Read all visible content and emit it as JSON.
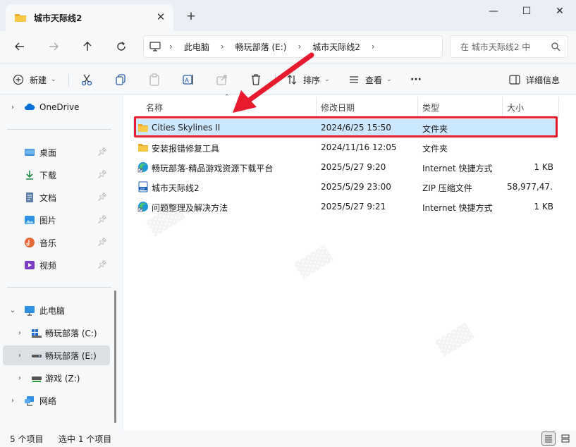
{
  "window": {
    "tab_title": "城市天际线2",
    "close_tab_glyph": "✕",
    "new_tab_glyph": "+",
    "minimize_glyph": "—",
    "maximize_glyph": "☐",
    "close_glyph": "✕"
  },
  "address": {
    "breadcrumbs": [
      "此电脑",
      "畅玩部落 (E:)",
      "城市天际线2"
    ],
    "separator": "›",
    "search_placeholder": "在 城市天际线2 中"
  },
  "toolbar": {
    "new_label": "新建",
    "sort_label": "排序",
    "view_label": "查看",
    "more_label": "···",
    "details_label": "详细信息"
  },
  "sidebar": {
    "onedrive": "OneDrive",
    "quick_access": [
      {
        "label": "桌面",
        "icon": "desktop-icon"
      },
      {
        "label": "下载",
        "icon": "download-icon"
      },
      {
        "label": "文档",
        "icon": "documents-icon"
      },
      {
        "label": "图片",
        "icon": "pictures-icon"
      },
      {
        "label": "音乐",
        "icon": "music-icon"
      },
      {
        "label": "视频",
        "icon": "videos-icon"
      }
    ],
    "this_pc": "此电脑",
    "drives": [
      {
        "label": "畅玩部落 (C:)"
      },
      {
        "label": "畅玩部落 (E:)"
      },
      {
        "label": "游戏 (Z:)"
      }
    ],
    "network": "网络"
  },
  "columns": {
    "name": "名称",
    "date": "修改日期",
    "type": "类型",
    "size": "大小"
  },
  "files": [
    {
      "name": "Cities Skylines II",
      "date": "2024/6/25 15:50",
      "type": "文件夹",
      "size": "",
      "icon": "folder-icon"
    },
    {
      "name": "安装报错修复工具",
      "date": "2024/11/16 12:05",
      "type": "文件夹",
      "size": "",
      "icon": "folder-icon"
    },
    {
      "name": "畅玩部落-精品游戏资源下载平台",
      "date": "2025/5/27 9:20",
      "type": "Internet 快捷方式",
      "size": "1 KB",
      "icon": "edge-shortcut-icon"
    },
    {
      "name": "城市天际线2",
      "date": "2025/5/29 23:00",
      "type": "ZIP 压缩文件",
      "size": "58,977,47...",
      "icon": "zip-file-icon"
    },
    {
      "name": "问题整理及解决方法",
      "date": "2025/5/27 9:21",
      "type": "Internet 快捷方式",
      "size": "1 KB",
      "icon": "edge-shortcut-icon"
    }
  ],
  "status": {
    "count": "5 个项目",
    "selected": "选中 1 个项目"
  },
  "colors": {
    "accent": "#0067c0",
    "folder": "#f7c948",
    "selection": "#cce8ff",
    "annotation_red": "#e81b2e"
  }
}
